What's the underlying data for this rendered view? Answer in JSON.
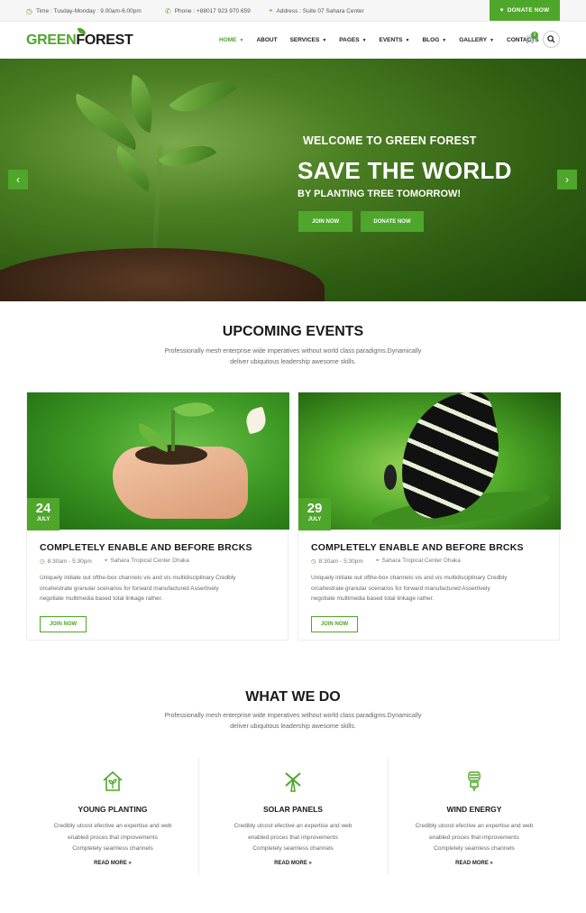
{
  "topbar": {
    "time": "Time : Tusday-Monday : 9.00am-6.00pm",
    "phone": "Phone : +88017 923 970 659",
    "address": "Address : Suite 07 Sahara Center",
    "donate": "DONATE NOW"
  },
  "header": {
    "logo_green": "GREEN",
    "logo_dark": "FOREST",
    "nav": [
      "HOME",
      "ABOUT",
      "SERVICES",
      "PAGES",
      "EVENTS",
      "BLOG",
      "GALLERY",
      "CONTACTS"
    ],
    "cart_count": "0"
  },
  "hero": {
    "welcome": "WELCOME TO GREEN FOREST",
    "title": "SAVE THE WORLD",
    "subtitle": "BY PLANTING TREE TOMORROW!",
    "btn_join": "JOIN NOW",
    "btn_donate": "DONATE NOW"
  },
  "events": {
    "title": "UPCOMING EVENTS",
    "desc_line1": "Professionally mesh enterprise wide imperatives without world class paradigms.Dynamically",
    "desc_line2": "deliver ubiquitous leadership awesome skills.",
    "cards": [
      {
        "day": "24",
        "month": "JULY",
        "title": "COMPLETELY ENABLE AND BEFORE BRCKS",
        "time": "8:30am - 5:30pm",
        "location": "Sahara Tropical Center Dhaka",
        "desc1": "Uniquely initiate out ofthe-box channels vis and vis multidisciplinary Credbly",
        "desc2": "orcahestrate granular scenarios for forward manufactured Assertively",
        "desc3": "negotiate multimedia based total linkage rather.",
        "button": "JOIN NOW"
      },
      {
        "day": "29",
        "month": "JULY",
        "title": "COMPLETELY ENABLE AND BEFORE BRCKS",
        "time": "8:30am - 5:30pm",
        "location": "Sahara Tropical Center Dhaka",
        "desc1": "Uniquely initiate out ofthe-box channels vis and vis multidisciplinary Credbly",
        "desc2": "orcahestrate granular scenarios for forward manufactured Assertively",
        "desc3": "negotiate multimedia based total linkage rather.",
        "button": "JOIN NOW"
      }
    ]
  },
  "services": {
    "title": "WHAT WE DO",
    "desc_line1": "Professionally mesh enterprise wide imperatives without world class paradigms.Dynamically",
    "desc_line2": "deliver ubiquitous leadership awesome skills.",
    "items": [
      {
        "icon": "house-plant-icon",
        "title": "YOUNG PLANTING",
        "d1": "Credibly utcost efective an expertise and web",
        "d2": "enabled proces that improvements",
        "d3": "Completely seamless channels",
        "more": "READ MORE »"
      },
      {
        "icon": "windmill-icon",
        "title": "SOLAR PANELS",
        "d1": "Credibly utcost efective an expertise and web",
        "d2": "enabled proces that improvements",
        "d3": "Completely seamless channels",
        "more": "READ MORE »"
      },
      {
        "icon": "eco-bulb-icon",
        "title": "WIND ENERGY",
        "d1": "Credibly utcost efective an expertise and web",
        "d2": "enabled proces that improvements",
        "d3": "Completely seamless channels",
        "more": "READ MORE »"
      }
    ]
  },
  "colors": {
    "accent": "#4ea62a",
    "dark": "#1a1a1a"
  }
}
